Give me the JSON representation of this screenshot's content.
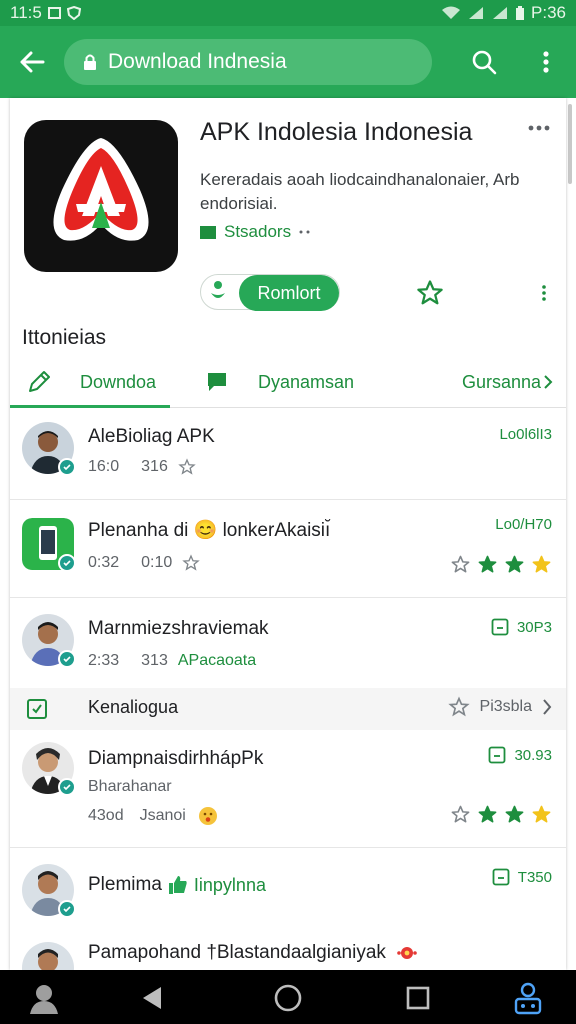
{
  "status_bar": {
    "left_text": "11:5",
    "time": "P:36"
  },
  "app_bar": {
    "url_text": "Download Indnesia"
  },
  "app": {
    "title": "APK Indolesia Indonesia",
    "description": "Kereradais aoah liodcaindhanalonaier, Arb endorisiai.",
    "developer": "Stsadors",
    "install_label": "Romlort"
  },
  "section_title": "Ittonieias",
  "tabs": [
    {
      "label": "Downdoa"
    },
    {
      "label": "Dyanamsan"
    },
    {
      "label": "Gursanna"
    }
  ],
  "rows": [
    {
      "title": "AleBioliag APK",
      "meta1": "16:0",
      "meta2": "316",
      "right": "Lo0l6lI3",
      "rating": 0
    },
    {
      "title": "Plenanha di 😊 lonkerAkaisiı̆",
      "meta1": "0:32",
      "meta2": "0:10",
      "right": "Lo0/H70",
      "rating": 2.5
    },
    {
      "title": "Marnmiezshraviemak",
      "meta1": "2:33",
      "meta2": "313",
      "extra": "APacaoata",
      "right": "30P3",
      "rating": 0
    },
    {
      "title": "DiampnaisdirhhápPk",
      "subtitle": "Bharahanar",
      "meta1": "43od",
      "meta2": "Jsanoi",
      "right": "30.93",
      "rating": 2.5
    },
    {
      "title": "Plemima",
      "tag": "Iinpylnna",
      "right": "T350"
    },
    {
      "title": "Pamapohand †Blastandaalgianiyak"
    }
  ],
  "subhead": {
    "title": "Kenaliogua",
    "right": "Pi3sbla"
  },
  "colors": {
    "brand": "#27a857",
    "status_bar": "#1e9b4b",
    "link_green": "#1e8e3e",
    "star_gold": "#f2c31b"
  }
}
